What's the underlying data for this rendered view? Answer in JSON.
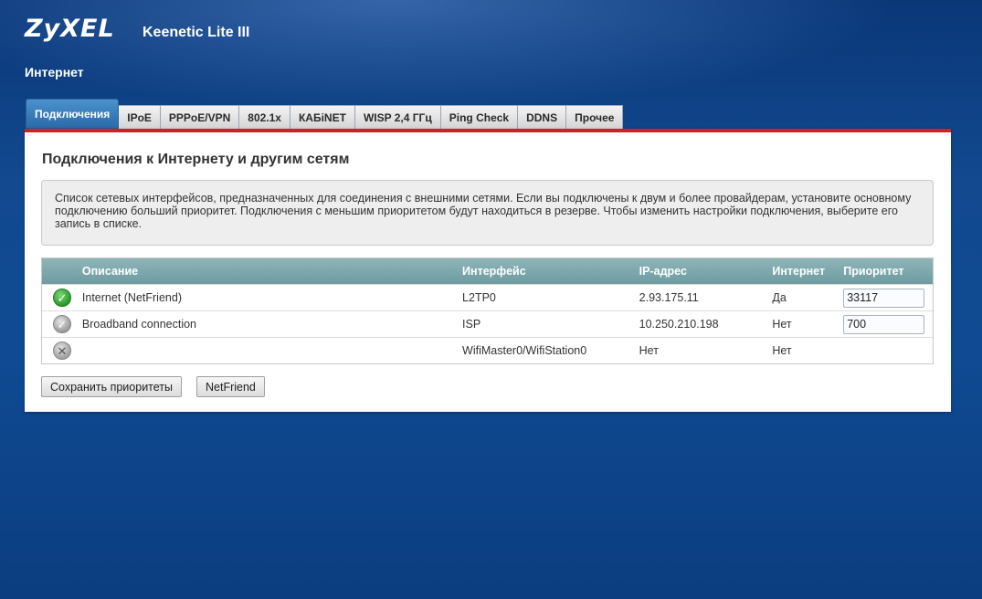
{
  "header": {
    "logo": "ZyXEL",
    "model": "Keenetic Lite III",
    "section": "Интернет"
  },
  "tabs": [
    {
      "label": "Подключения",
      "active": true
    },
    {
      "label": "IPoE"
    },
    {
      "label": "PPPoE/VPN"
    },
    {
      "label": "802.1x"
    },
    {
      "label": "КАБiNET"
    },
    {
      "label": "WISP 2,4 ГГц"
    },
    {
      "label": "Ping Check"
    },
    {
      "label": "DDNS"
    },
    {
      "label": "Прочее"
    }
  ],
  "panel": {
    "title": "Подключения к Интернету и другим сетям",
    "description": "Список сетевых интерфейсов, предназначенных для соединения с внешними сетями. Если вы подключены к двум и более провайдерам, установите основному подключению больший приоритет. Подключения с меньшим приоритетом будут находиться в резерве. Чтобы изменить настройки подключения, выберите его запись в списке."
  },
  "table": {
    "headers": {
      "description": "Описание",
      "interface": "Интерфейс",
      "ip": "IP-адрес",
      "internet": "Интернет",
      "priority": "Приоритет"
    },
    "rows": [
      {
        "status": "check-icon",
        "description": "Internet (NetFriend)",
        "interface": "L2TP0",
        "ip": "2.93.175.11",
        "internet": "Да",
        "priority": "33117"
      },
      {
        "status": "check-gray-icon",
        "description": "Broadband connection",
        "interface": "ISP",
        "ip": "10.250.210.198",
        "internet": "Нет",
        "priority": "700"
      },
      {
        "status": "cross-icon",
        "description": "",
        "interface": "WifiMaster0/WifiStation0",
        "ip": "Нет",
        "internet": "Нет",
        "priority": ""
      }
    ]
  },
  "buttons": {
    "save": "Сохранить приоритеты",
    "netfriend": "NetFriend"
  },
  "colors": {
    "accent_red": "#d0202a",
    "tab_active": "#2a6aa8",
    "table_header": "#7aa7ab"
  }
}
